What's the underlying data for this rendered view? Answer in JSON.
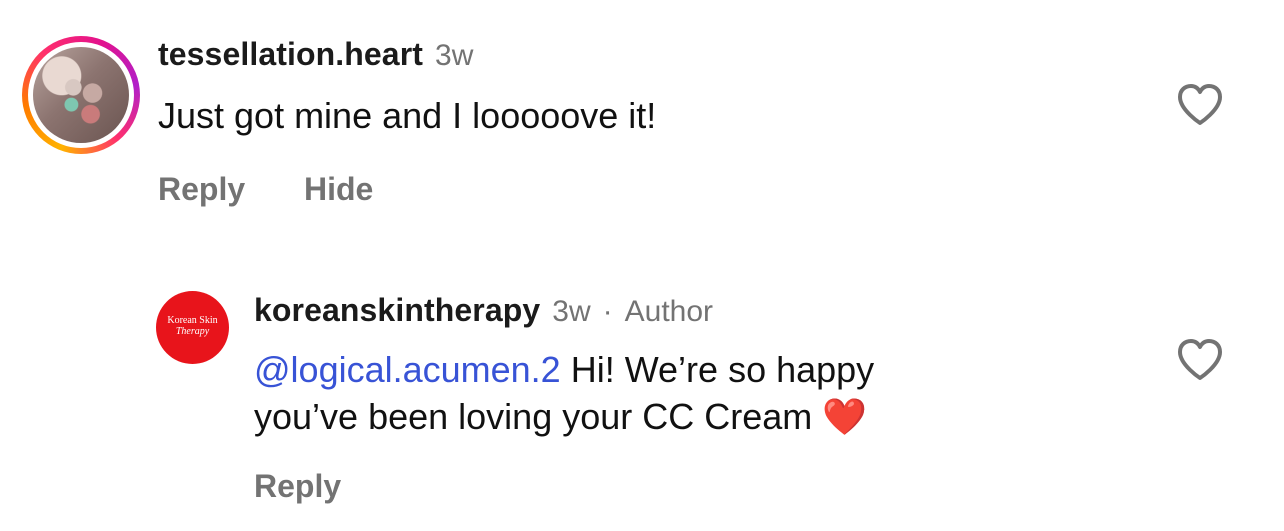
{
  "comments": [
    {
      "username": "tessellation.heart",
      "time": "3w",
      "text": "Just got mine and I looooove it!",
      "actions": {
        "reply": "Reply",
        "hide": "Hide"
      },
      "like_icon": "heart-outline-icon"
    },
    {
      "username": "koreanskintherapy",
      "time": "3w",
      "separator": "·",
      "badge": "Author",
      "mention": "@logical.acumen.2",
      "text_line1": " Hi! We’re so happy",
      "text_line2": "you’ve been loving your CC Cream ",
      "emoji": "❤️",
      "avatar_logo": {
        "line1": "Korean Skin",
        "line2": "Therapy",
        "bg_color": "#e8141b"
      },
      "actions": {
        "reply": "Reply"
      },
      "like_icon": "heart-outline-icon"
    }
  ],
  "colors": {
    "mention": "#3853d6",
    "secondary_text": "#737373",
    "primary_text": "#111111"
  }
}
